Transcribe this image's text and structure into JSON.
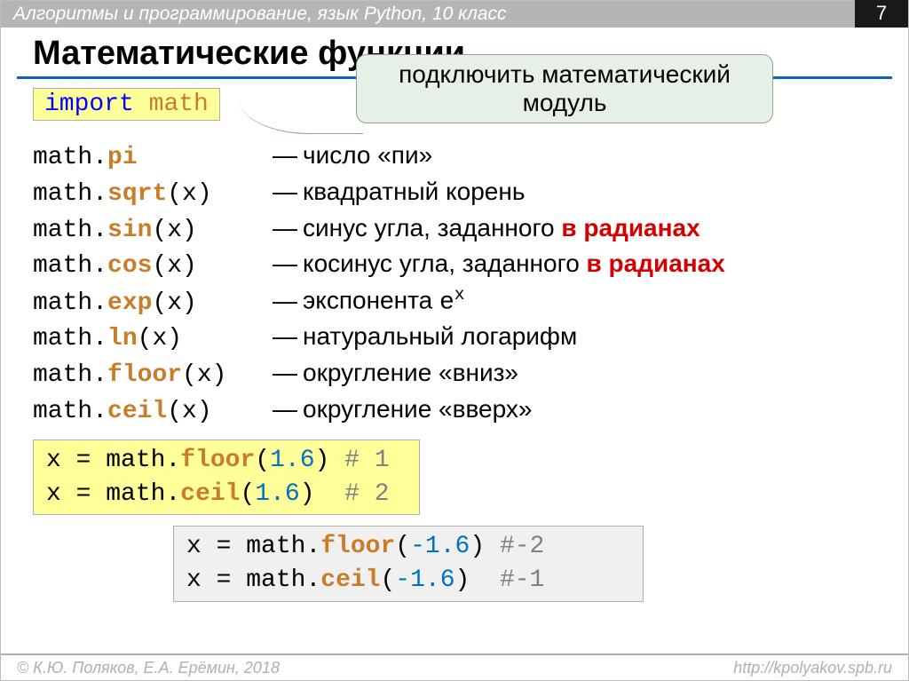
{
  "topbar": {
    "title": "Алгоритмы и программирование, язык Python, 10 класс",
    "page_number": "7"
  },
  "heading": "Математические функции",
  "import_box": {
    "kw": "import",
    "mod": "math"
  },
  "callout": "подключить математический модуль",
  "funcs": [
    {
      "mod": "math",
      "fn": "pi",
      "args": "",
      "desc_pre": "число «пи»",
      "desc_red": "",
      "desc_post": ""
    },
    {
      "mod": "math",
      "fn": "sqrt",
      "args": "(x)",
      "desc_pre": "квадратный корень",
      "desc_red": "",
      "desc_post": ""
    },
    {
      "mod": "math",
      "fn": "sin",
      "args": "(x)",
      "desc_pre": "синус угла, заданного ",
      "desc_red": "в радианах",
      "desc_post": ""
    },
    {
      "mod": "math",
      "fn": "cos",
      "args": "(x)",
      "desc_pre": "косинус угла, заданного ",
      "desc_red": "в радианах",
      "desc_post": ""
    },
    {
      "mod": "math",
      "fn": "exp",
      "args": "(x)",
      "desc_pre": "экспонента ",
      "desc_red": "",
      "desc_post": "e",
      "super": "x"
    },
    {
      "mod": "math",
      "fn": "ln",
      "args": "(x)",
      "desc_pre": "натуральный логарифм",
      "desc_red": "",
      "desc_post": ""
    },
    {
      "mod": "math",
      "fn": "floor",
      "args": "(x)",
      "desc_pre": "округление «вниз»",
      "desc_red": "",
      "desc_post": ""
    },
    {
      "mod": "math",
      "fn": "ceil",
      "args": "(x)",
      "desc_pre": "округление «вверх»",
      "desc_red": "",
      "desc_post": ""
    }
  ],
  "code1": [
    {
      "var": "x",
      "mod": "math",
      "fn": "floor",
      "num": "1.6",
      "cmt": "# 1"
    },
    {
      "var": "x",
      "mod": "math",
      "fn": "ceil",
      "num": "1.6",
      "cmt": "# 2"
    }
  ],
  "code2": [
    {
      "var": "x",
      "mod": "math",
      "fn": "floor",
      "num": "-1.6",
      "cmt": "#-2"
    },
    {
      "var": "x",
      "mod": "math",
      "fn": "ceil",
      "num": "-1.6",
      "cmt": "#-1"
    }
  ],
  "footer": {
    "left": "© К.Ю. Поляков, Е.А. Ерёмин, 2018",
    "right": "http://kpolyakov.spb.ru"
  }
}
